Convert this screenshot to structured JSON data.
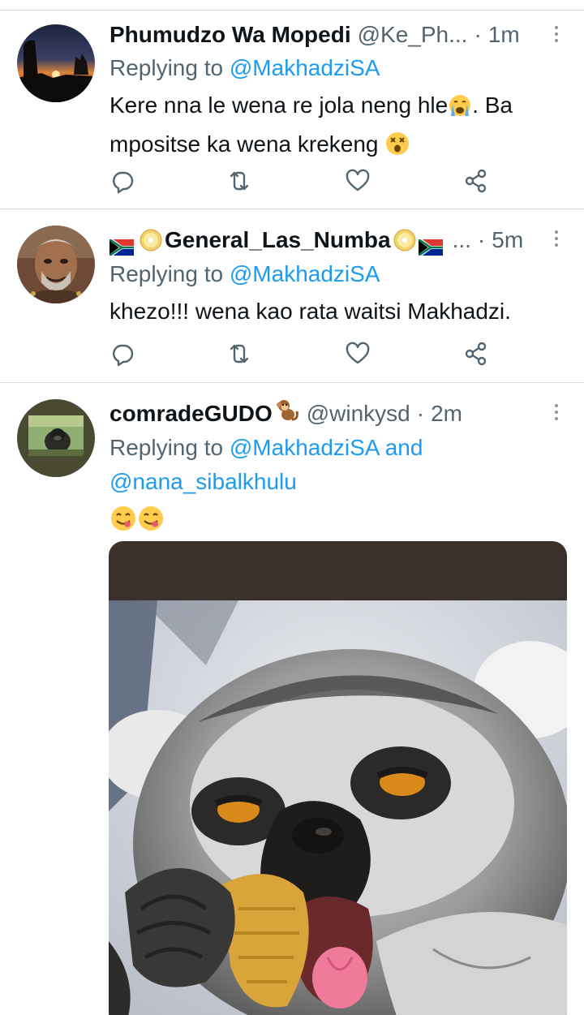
{
  "tweets": [
    {
      "display_name": "Phumudzo Wa Mopedi",
      "handle": "@Ke_Ph...",
      "separator": "·",
      "time": "1m",
      "replying_prefix": "Replying to",
      "mentions": [
        "@MakhadziSA"
      ],
      "text_part1": "Kere nna le wena re jola neng hle",
      "text_part2": ". Ba mpositse ka wena krekeng",
      "emojis": [
        "crying-face",
        "dizzy-face"
      ]
    },
    {
      "display_name": "General_Las_Numba",
      "handle": "...",
      "separator": "·",
      "time": "5m",
      "replying_prefix": "Replying to",
      "mentions": [
        "@MakhadziSA"
      ],
      "text_part1": "khezo!!! wena kao rata waitsi Makhadzi.",
      "emojis": [
        "south-africa-flag",
        "disc",
        "disc",
        "south-africa-flag"
      ]
    },
    {
      "display_name": "comradeGUDO",
      "handle": "@winkysd",
      "separator": "·",
      "time": "2m",
      "replying_prefix": "Replying to",
      "mentions": [
        "@MakhadziSA",
        "@nana_sibalkhulu"
      ],
      "mention_joiner": "and",
      "emojis": [
        "monkey",
        "yum-face",
        "yum-face"
      ],
      "media": "lemur-eating-photo"
    }
  ],
  "colors": {
    "text": "#0f1419",
    "secondary": "#536471",
    "link": "#1d9bf0",
    "divider": "#d8dde1",
    "icon": "#536471"
  },
  "icons": [
    "reply-icon",
    "retweet-icon",
    "like-icon",
    "share-icon",
    "more-icon"
  ]
}
